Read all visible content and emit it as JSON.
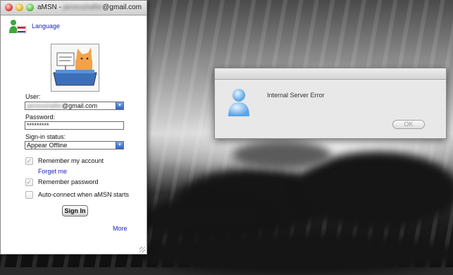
{
  "window": {
    "app_name": "aMSN",
    "title_separator": " - ",
    "account_hidden": "jamesshafiei",
    "account_domain": "@gmail.com"
  },
  "login": {
    "language_link": "Language",
    "user_label": "User:",
    "user_hidden": "jamesshafiei",
    "user_domain": "@gmail.com",
    "password_label": "Password:",
    "password_value": "*********",
    "status_label": "Sign-in status:",
    "status_value": "Appear Offline",
    "remember_account": {
      "label": "Remember my account",
      "checked": true
    },
    "forget_link": "Forget me",
    "remember_password": {
      "label": "Remember password",
      "checked": true
    },
    "auto_connect": {
      "label": "Auto-connect when aMSN starts",
      "checked": false
    },
    "signin_button": "Sign In",
    "more_link": "More"
  },
  "dialog": {
    "message": "Internal Server Error",
    "ok_button": "OK"
  },
  "icons": {
    "checkmark_glyph": "✓",
    "combo_arrow_glyph": "▾"
  },
  "colors": {
    "link": "#1a24b8",
    "combo_accent": "#2f63c4"
  }
}
